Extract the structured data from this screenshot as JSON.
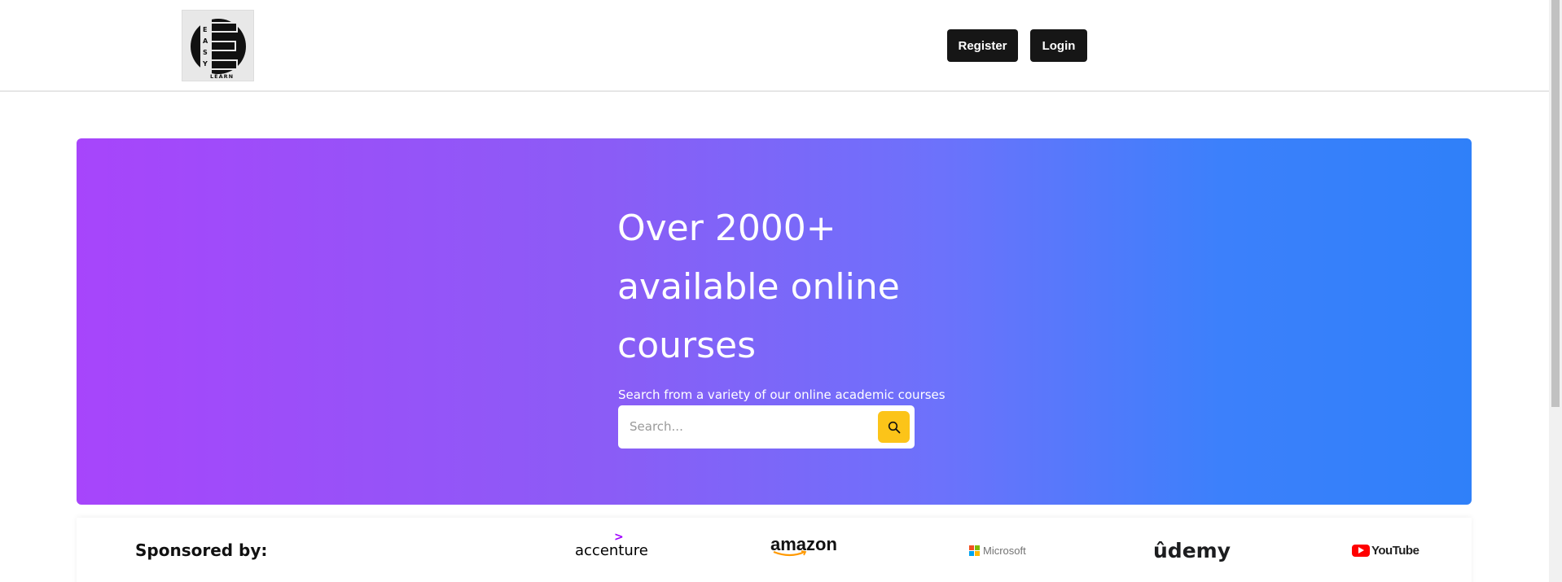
{
  "header": {
    "logo_text": "EASY LEARN",
    "register_label": "Register",
    "login_label": "Login"
  },
  "hero": {
    "title": "Over 2000+ available online courses",
    "subtitle": "Search from a variety of our online academic courses",
    "search_placeholder": "Search..."
  },
  "sponsors": {
    "title": "Sponsored by:",
    "items": [
      "accenture",
      "amazon",
      "Microsoft",
      "ûdemy",
      "YouTube"
    ]
  },
  "colors": {
    "hero_gradient_start": "#a745fb",
    "hero_gradient_end": "#2f80f9",
    "search_button": "#fcc419",
    "nav_button": "#161616"
  },
  "icons": [
    "easy-learn-logo",
    "search-icon",
    "microsoft-logo-icon",
    "youtube-play-icon"
  ]
}
